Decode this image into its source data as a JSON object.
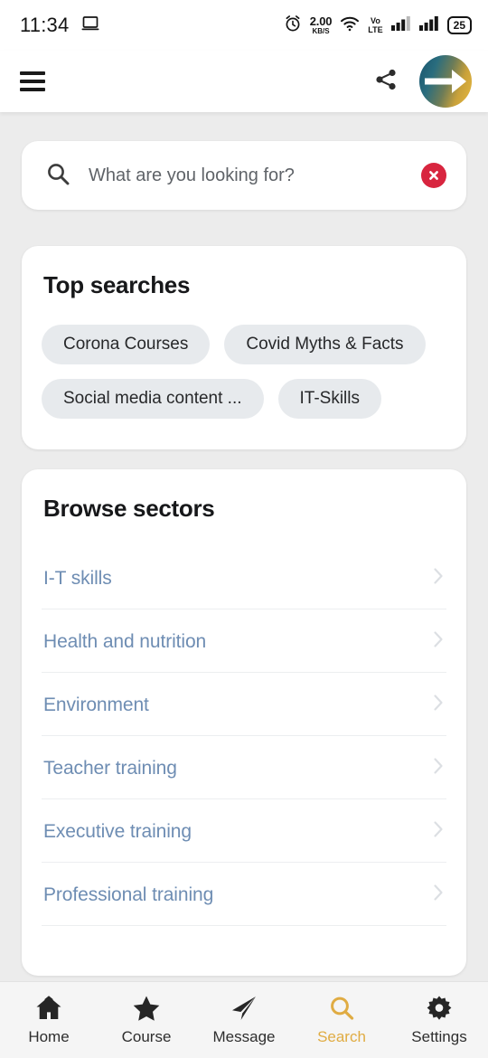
{
  "status_bar": {
    "time": "11:34",
    "cast_icon": "laptop-cast-icon",
    "alarm_icon": "alarm-clock-icon",
    "network_speed_value": "2.00",
    "network_speed_unit": "KB/S",
    "wifi_icon": "wifi-icon",
    "volte_line1": "Vo",
    "volte_line2": "LTE",
    "signal_icon_1": "signal-bars-icon",
    "signal_icon_2": "signal-bars-icon",
    "battery_level": "25"
  },
  "app_bar": {
    "menu_icon": "hamburger-menu-icon",
    "share_icon": "share-icon",
    "avatar_icon": "brand-logo-avatar"
  },
  "search": {
    "placeholder": "What are you looking for?",
    "value": "",
    "search_icon": "search-icon",
    "clear_icon": "clear-circle-icon",
    "clear_color": "#d8253f"
  },
  "top_searches": {
    "title": "Top searches",
    "chips": [
      "Corona Courses",
      "Covid Myths & Facts",
      "Social media content ...",
      "IT-Skills"
    ]
  },
  "browse_sectors": {
    "title": "Browse sectors",
    "link_color": "#6e8db3",
    "items": [
      {
        "label": "I-T skills"
      },
      {
        "label": "Health and nutrition"
      },
      {
        "label": "Environment"
      },
      {
        "label": "Teacher training"
      },
      {
        "label": "Executive training"
      },
      {
        "label": "Professional training"
      }
    ]
  },
  "bottom_nav": {
    "active_color": "#e0ac43",
    "items": [
      {
        "label": "Home",
        "icon": "home-icon",
        "active": false
      },
      {
        "label": "Course",
        "icon": "star-icon",
        "active": false
      },
      {
        "label": "Message",
        "icon": "paper-plane-icon",
        "active": false
      },
      {
        "label": "Search",
        "icon": "search-icon",
        "active": true
      },
      {
        "label": "Settings",
        "icon": "gear-icon",
        "active": false
      }
    ]
  }
}
